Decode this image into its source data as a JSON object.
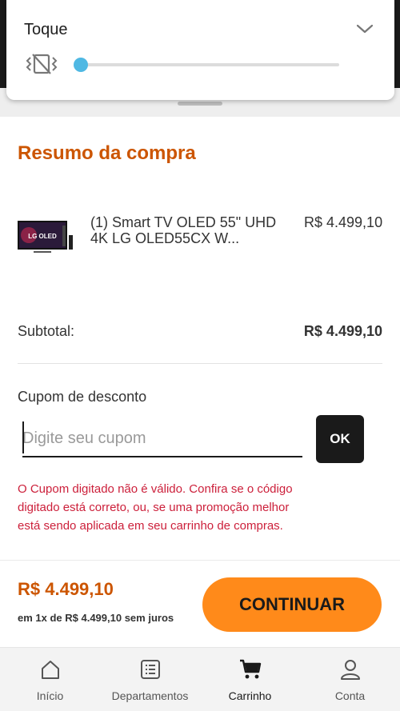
{
  "volume_panel": {
    "title": "Toque",
    "icon_mute": "vibrate-mute-icon",
    "icon_chevron": "chevron-down-icon",
    "level": 0,
    "accent": "#4fb8e3"
  },
  "summary": {
    "title": "Resumo da compra",
    "product": {
      "name": "(1) Smart TV OLED 55\" UHD 4K LG OLED55CX W...",
      "price": "R$ 4.499,10",
      "thumb_label": "LG OLED"
    },
    "subtotal_label": "Subtotal:",
    "subtotal_value": "R$ 4.499,10"
  },
  "coupon": {
    "label": "Cupom de desconto",
    "placeholder": "Digite seu cupom",
    "value": "",
    "ok_label": "OK",
    "error": "O Cupom digitado não é válido. Confira se o código digitado está correto, ou, se uma promoção melhor está sendo aplicada em seu carrinho de compras."
  },
  "footer": {
    "total": "R$ 4.499,10",
    "installments": "em 1x de R$ 4.499,10 sem juros",
    "continue_label": "CONTINUAR"
  },
  "nav": {
    "items": [
      {
        "label": "Início",
        "icon": "home-icon"
      },
      {
        "label": "Departamentos",
        "icon": "list-icon"
      },
      {
        "label": "Carrinho",
        "icon": "cart-icon"
      },
      {
        "label": "Conta",
        "icon": "user-icon"
      }
    ],
    "active": "Carrinho"
  },
  "colors": {
    "brand_orange": "#cc5500",
    "button_orange": "#ff8a1a",
    "error_red": "#cc1f3a"
  }
}
